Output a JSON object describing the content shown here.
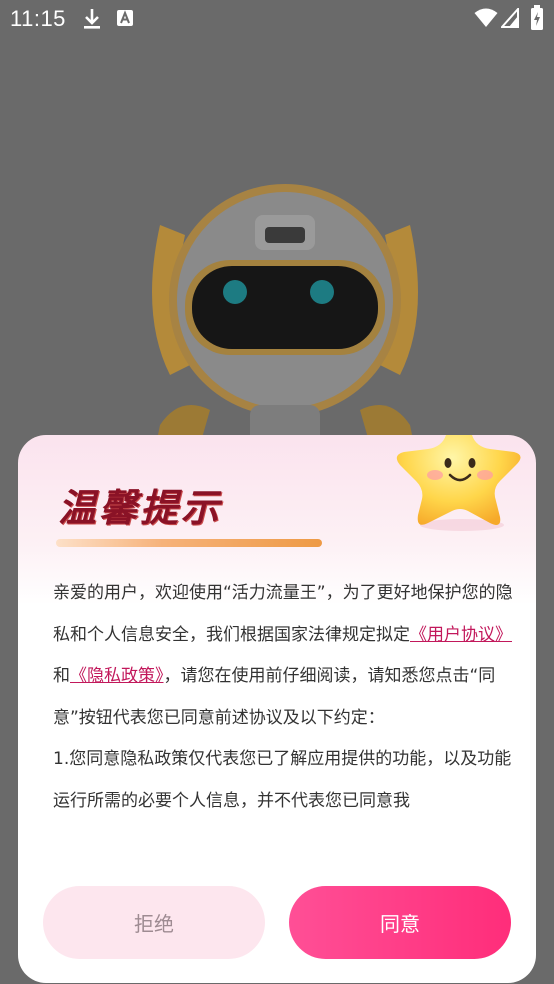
{
  "status_bar": {
    "time": "11:15",
    "icons": [
      "download-icon",
      "a-notification-icon",
      "wifi-icon",
      "signal-icon",
      "battery-icon"
    ]
  },
  "dialog": {
    "title": "温馨提示",
    "body": {
      "intro_1": "亲爱的用户，欢迎使用“活力流量王”，为了更好地保护您的隐私和个人信息安全，我们根据国家法律规定拟定",
      "user_agreement_link": "《用户协议》",
      "and": "和",
      "privacy_policy_link": "《隐私政策》",
      "intro_2": "，请您在使用前仔细阅读，请知悉您点击“同意”按钮代表您已同意前述协议及以下约定：",
      "item_1": "1.您同意隐私政策仅代表您已了解应用提供的功能，以及功能运行所需的必要个人信息，并不代表您已同意我"
    },
    "reject_label": "拒绝",
    "agree_label": "同意"
  },
  "colors": {
    "title": "#8a1226",
    "link": "#c2185b",
    "agree_button": "#ff3b85",
    "reject_button": "#fde6ee"
  }
}
